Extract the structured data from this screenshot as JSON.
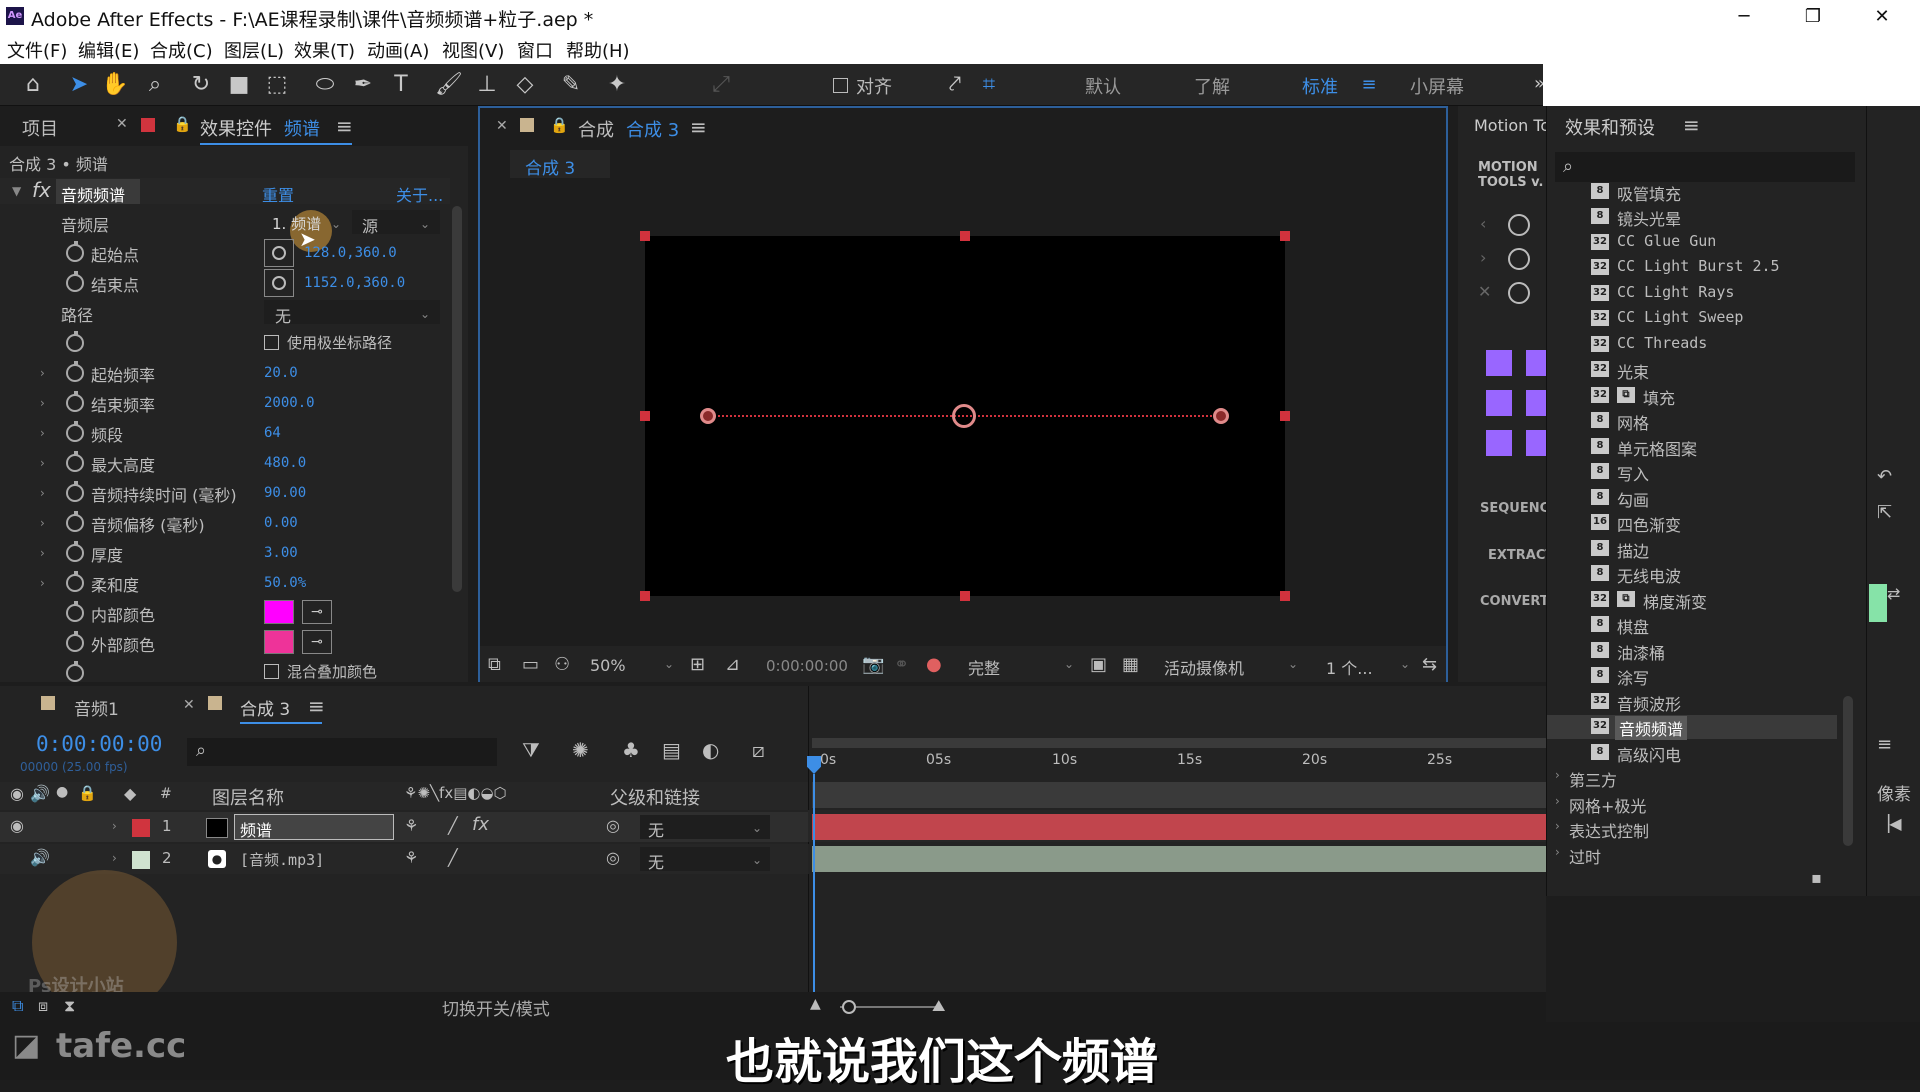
{
  "window": {
    "app_icon": "Ae",
    "title": "Adobe After Effects - F:\\AE课程录制\\课件\\音频频谱+粒子.aep *",
    "minimize": "─",
    "restore": "❐",
    "close": "✕"
  },
  "menu": [
    "文件(F)",
    "编辑(E)",
    "合成(C)",
    "图层(L)",
    "效果(T)",
    "动画(A)",
    "视图(V)",
    "窗口",
    "帮助(H)"
  ],
  "toolbar": {
    "snap_label": "对齐",
    "workspaces": [
      "默认",
      "了解",
      "标准",
      "小屏幕"
    ],
    "active_workspace": "标准",
    "more": "»"
  },
  "left_panel": {
    "tab_project": "项目",
    "tab_effects": "效果控件",
    "tab_effects_layer": "频谱",
    "breadcrumb": "合成 3 • 频谱",
    "effect_name": "音频频谱",
    "reset": "重置",
    "about": "关于...",
    "audio_layer_label": "音频层",
    "audio_layer_value": "1. 频谱",
    "audio_layer_source": "源",
    "start_point_label": "起始点",
    "start_point_value": "128.0,360.0",
    "end_point_label": "结束点",
    "end_point_value": "1152.0,360.0",
    "path_label": "路径",
    "path_value": "无",
    "polar_label": "使用极坐标路径",
    "props": [
      {
        "label": "起始频率",
        "value": "20.0"
      },
      {
        "label": "结束频率",
        "value": "2000.0"
      },
      {
        "label": "频段",
        "value": "64"
      },
      {
        "label": "最大高度",
        "value": "480.0"
      },
      {
        "label": "音频持续时间 (毫秒)",
        "value": "90.00"
      },
      {
        "label": "音频偏移 (毫秒)",
        "value": "0.00"
      },
      {
        "label": "厚度",
        "value": "3.00"
      },
      {
        "label": "柔和度",
        "value": "50.0%"
      }
    ],
    "inner_color_label": "内部颜色",
    "outer_color_label": "外部颜色",
    "blend_label": "混合叠加颜色",
    "inner_color": "#ff00ff",
    "outer_color": "#ee3399"
  },
  "comp_panel": {
    "tab_prefix": "合成",
    "tab_name": "合成 3",
    "subtab": "合成 3",
    "zoom": "50%",
    "timecode": "0:00:00:00",
    "quality": "完整",
    "camera": "活动摄像机",
    "views": "1 个..."
  },
  "side_panel": {
    "tab": "Motion Tools",
    "logo_line1": "MOTION",
    "logo_line2": "TOOLS v.",
    "labels": [
      "SEQUENCE",
      "EXTRACT",
      "CONVERT"
    ],
    "accent": "#9966ff"
  },
  "effects_presets": {
    "tab": "效果和预设",
    "search_placeholder": "",
    "items": [
      {
        "bits": "8",
        "name": "吸管填充"
      },
      {
        "bits": "8",
        "name": "镜头光晕"
      },
      {
        "bits": "32",
        "name": "CC Glue Gun"
      },
      {
        "bits": "32",
        "name": "CC Light Burst 2.5"
      },
      {
        "bits": "32",
        "name": "CC Light Rays"
      },
      {
        "bits": "32",
        "name": "CC Light Sweep"
      },
      {
        "bits": "32",
        "name": "CC Threads"
      },
      {
        "bits": "32",
        "name": "光束"
      },
      {
        "bits": "32",
        "name": "填充"
      },
      {
        "bits": "8",
        "name": "网格"
      },
      {
        "bits": "8",
        "name": "单元格图案"
      },
      {
        "bits": "8",
        "name": "写入"
      },
      {
        "bits": "8",
        "name": "勾画"
      },
      {
        "bits": "16",
        "name": "四色渐变"
      },
      {
        "bits": "8",
        "name": "描边"
      },
      {
        "bits": "8",
        "name": "无线电波"
      },
      {
        "bits": "32",
        "name": "梯度渐变"
      },
      {
        "bits": "8",
        "name": "棋盘"
      },
      {
        "bits": "8",
        "name": "油漆桶"
      },
      {
        "bits": "8",
        "name": "涂写"
      },
      {
        "bits": "32",
        "name": "音频波形"
      },
      {
        "bits": "32",
        "name": "音频频谱"
      },
      {
        "bits": "8",
        "name": "高级闪电"
      }
    ],
    "selected": "音频频谱",
    "folders": [
      "第三方",
      "网格+极光",
      "表达式控制",
      "过时"
    ],
    "right_label": "像素"
  },
  "timeline": {
    "tab1": "音频1",
    "tab2": "合成 3",
    "timecode": "0:00:00:00",
    "timecode_sub": "00000 (25.00 fps)",
    "col_hash": "#",
    "col_name": "图层名称",
    "col_parent": "父级和链接",
    "ruler": [
      "0s",
      "05s",
      "10s",
      "15s",
      "20s",
      "25s"
    ],
    "layers": [
      {
        "num": "1",
        "name": "频谱",
        "parent": "无",
        "color": "#d0343e",
        "bar": "#c1454d"
      },
      {
        "num": "2",
        "name": "[音频.mp3]",
        "parent": "无",
        "color": "#cfe2cf",
        "bar": "#8a9a8a"
      }
    ],
    "toggle_label": "切换开关/模式"
  },
  "watermark": {
    "site": "tafe.cc",
    "avatar_text": "Ps设计小站"
  },
  "subtitle": "也就说我们这个频谱"
}
